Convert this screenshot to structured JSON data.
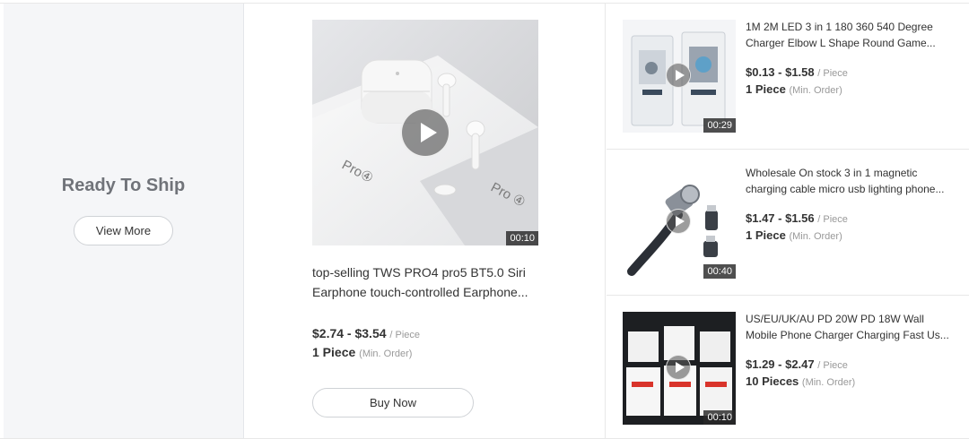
{
  "ready_to_ship": {
    "title": "Ready To Ship",
    "view_more": "View More"
  },
  "featured": {
    "title_line1": "top-selling TWS PRO4 pro5 BT5.0 Siri",
    "title_line2": "Earphone touch-controlled Earphone...",
    "price": "$2.74 - $3.54",
    "price_unit": "/ Piece",
    "moq": "1 Piece",
    "moq_note": "(Min. Order)",
    "duration": "00:10",
    "buy_now": "Buy Now",
    "box_label": "Pro④",
    "box_label2": "Pro ④"
  },
  "items": [
    {
      "title_line1": "1M 2M LED 3 in 1 180 360 540 Degree",
      "title_line2": "Charger Elbow L Shape Round Game...",
      "price": "$0.13 - $1.58",
      "price_unit": "/ Piece",
      "moq": "1 Piece",
      "moq_note": "(Min. Order)",
      "duration": "00:29"
    },
    {
      "title_line1": "Wholesale On stock 3 in 1 magnetic",
      "title_line2": "charging cable micro usb lighting phone...",
      "price": "$1.47 - $1.56",
      "price_unit": "/ Piece",
      "moq": "1 Piece",
      "moq_note": "(Min. Order)",
      "duration": "00:40"
    },
    {
      "title_line1": "US/EU/UK/AU PD 20W PD 18W Wall",
      "title_line2": "Mobile Phone Charger Charging Fast Us...",
      "price": "$1.29 - $2.47",
      "price_unit": "/ Piece",
      "moq": "10 Pieces",
      "moq_note": "(Min. Order)",
      "duration": "00:10"
    }
  ],
  "colors": {
    "panel_bg": "#f5f6f8",
    "title_gray": "#707379",
    "border": "#e8e8e8",
    "text": "#333333",
    "muted": "#999999"
  }
}
